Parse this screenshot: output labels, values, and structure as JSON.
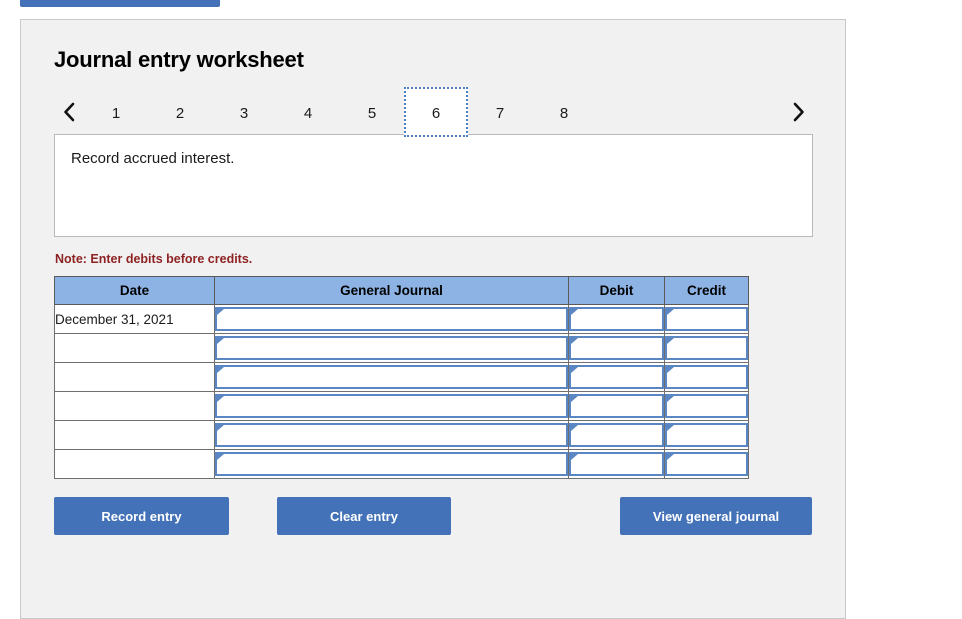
{
  "top_button": {
    "label": ""
  },
  "worksheet": {
    "title": "Journal entry worksheet",
    "prev_label": "previous",
    "next_label": "next",
    "tabs": [
      {
        "label": "1",
        "active": false
      },
      {
        "label": "2",
        "active": false
      },
      {
        "label": "3",
        "active": false
      },
      {
        "label": "4",
        "active": false
      },
      {
        "label": "5",
        "active": false
      },
      {
        "label": "6",
        "active": true
      },
      {
        "label": "7",
        "active": false
      },
      {
        "label": "8",
        "active": false
      }
    ],
    "description": "Record accrued interest.",
    "note": "Note: Enter debits before credits."
  },
  "journal_table": {
    "columns": [
      "Date",
      "General Journal",
      "Debit",
      "Credit"
    ],
    "rows": [
      {
        "date": "December 31, 2021",
        "general_journal": "",
        "debit": "",
        "credit": ""
      },
      {
        "date": "",
        "general_journal": "",
        "debit": "",
        "credit": ""
      },
      {
        "date": "",
        "general_journal": "",
        "debit": "",
        "credit": ""
      },
      {
        "date": "",
        "general_journal": "",
        "debit": "",
        "credit": ""
      },
      {
        "date": "",
        "general_journal": "",
        "debit": "",
        "credit": ""
      },
      {
        "date": "",
        "general_journal": "",
        "debit": "",
        "credit": ""
      }
    ]
  },
  "actions": {
    "record_entry": "Record entry",
    "clear_entry": "Clear entry",
    "view_general_journal": "View general journal"
  },
  "colors": {
    "button_blue": "#4472b8",
    "header_blue": "#8cb3e4",
    "field_border_blue": "#5b86c4",
    "note_red": "#8e2323",
    "panel_grey": "#f1f1f1"
  }
}
